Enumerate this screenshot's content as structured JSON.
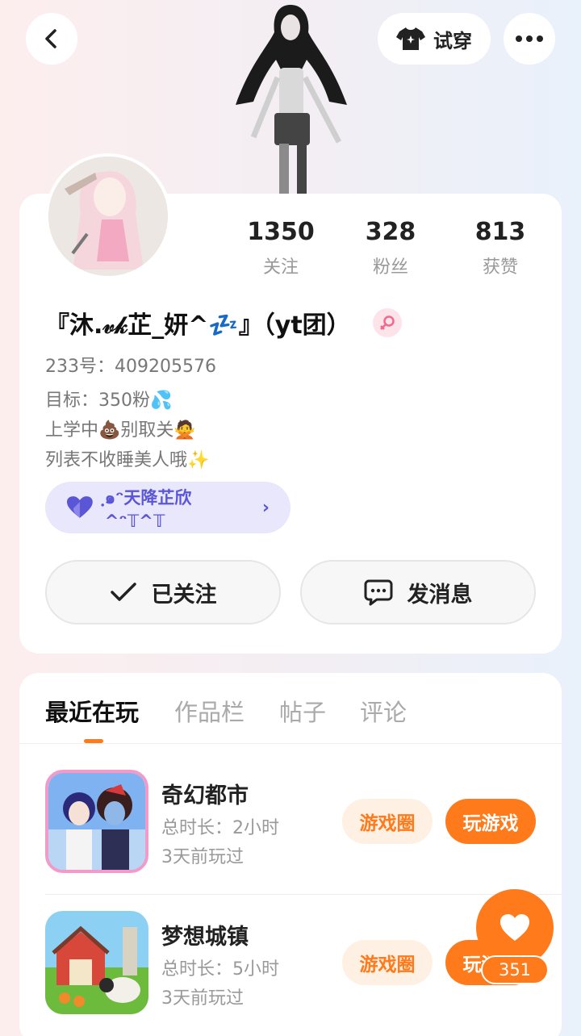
{
  "header": {
    "tryon_label": "试穿"
  },
  "profile": {
    "stats": [
      {
        "value": "1350",
        "label": "关注"
      },
      {
        "value": "328",
        "label": "粉丝"
      },
      {
        "value": "813",
        "label": "获赞"
      }
    ],
    "nickname": "『沐.𝓋𝓀芷_妍^💤』（yt团）",
    "uid": "233号：409205576",
    "bio": [
      "目标：350粉💦",
      "上学中💩别取关🙅",
      "列表不收睡美人哦✨"
    ],
    "group_tag": "ฺ๑ᵔ天降芷欣^ᵔ𝕋^𝕋",
    "follow_label": "已关注",
    "message_label": "发消息"
  },
  "tabs": [
    "最近在玩",
    "作品栏",
    "帖子",
    "评论"
  ],
  "games": [
    {
      "name": "奇幻都市",
      "duration": "总时长：2小时",
      "last_played": "3天前玩过",
      "circle_label": "游戏圈",
      "play_label": "玩游戏"
    },
    {
      "name": "梦想城镇",
      "duration": "总时长：5小时",
      "last_played": "3天前玩过",
      "circle_label": "游戏圈",
      "play_label": "玩游戏"
    }
  ],
  "like": {
    "count": "351"
  },
  "colors": {
    "accent": "#ff7a1a",
    "tag_bg": "#e8e7fb",
    "tag_text": "#5b56d6"
  }
}
